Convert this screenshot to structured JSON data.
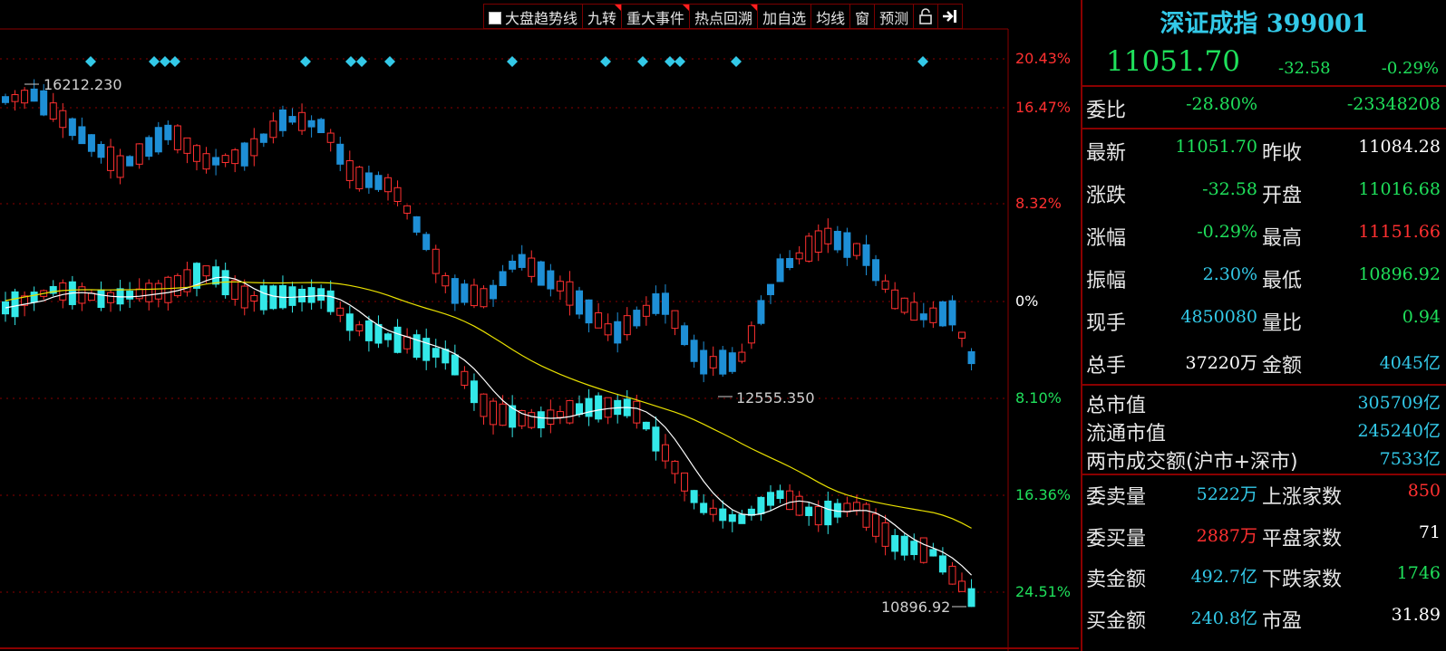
{
  "toolbar": {
    "checkbox_label": "大盘趋势线",
    "items": [
      "九转",
      "重大事件",
      "热点回溯",
      "加自选",
      "均线",
      "窗",
      "预测"
    ]
  },
  "chart_data": {
    "type": "candlestick",
    "reference_close": 11084.28,
    "pct_axis_labels": [
      {
        "label": "20.43%",
        "color": "#ff3030"
      },
      {
        "label": "16.47%",
        "color": "#ff3030"
      },
      {
        "label": "8.32%",
        "color": "#ff3030"
      },
      {
        "label": "0%",
        "color": "#ffffff"
      },
      {
        "label": "8.10%",
        "color": "#1fe05b"
      },
      {
        "label": "16.36%",
        "color": "#1fe05b"
      },
      {
        "label": "24.51%",
        "color": "#1fe05b"
      }
    ],
    "markers": [
      {
        "label": "16212.230",
        "kind": "high"
      },
      {
        "label": "12555.350",
        "kind": "low"
      },
      {
        "label": "10896.92",
        "kind": "low"
      }
    ],
    "colors": {
      "up": "#ff3030",
      "down_main": "#1e8fd6",
      "down_lower": "#33e8e8",
      "ma_short": "#ffffff",
      "ma_long": "#e8e000"
    }
  },
  "panel": {
    "title": "深证成指 399001",
    "price": "11051.70",
    "change": "-32.58",
    "change_pct": "-0.29%",
    "weibi": {
      "label": "委比",
      "pct": "-28.80%",
      "diff": "-23348208"
    },
    "quote_rows": [
      {
        "l1": "最新",
        "v1": "11051.70",
        "c1": "g",
        "l2": "昨收",
        "v2": "11084.28",
        "c2": "w"
      },
      {
        "l1": "涨跌",
        "v1": "-32.58",
        "c1": "g",
        "l2": "开盘",
        "v2": "11016.68",
        "c2": "g"
      },
      {
        "l1": "涨幅",
        "v1": "-0.29%",
        "c1": "g",
        "l2": "最高",
        "v2": "11151.66",
        "c2": "r"
      },
      {
        "l1": "振幅",
        "v1": "2.30%",
        "c1": "c",
        "l2": "最低",
        "v2": "10896.92",
        "c2": "g"
      },
      {
        "l1": "现手",
        "v1": "4850080",
        "c1": "c",
        "l2": "量比",
        "v2": "0.94",
        "c2": "g"
      },
      {
        "l1": "总手",
        "v1": "37220万",
        "c1": "w",
        "l2": "金额",
        "v2": "4045亿",
        "c2": "c"
      }
    ],
    "cap_rows": [
      {
        "label": "总市值",
        "value": "305709亿"
      },
      {
        "label": "流通市值",
        "value": "245240亿"
      },
      {
        "label": "两市成交额(沪市+深市)",
        "value": "7533亿"
      }
    ],
    "order_rows": [
      {
        "l1": "委卖量",
        "v1": "5222万",
        "c1": "c",
        "l2": "上涨家数",
        "v2": "850",
        "c2": "r"
      },
      {
        "l1": "委买量",
        "v1": "2887万",
        "c1": "r",
        "l2": "平盘家数",
        "v2": "71",
        "c2": "w"
      },
      {
        "l1": "卖金额",
        "v1": "492.7亿",
        "c1": "c",
        "l2": "下跌家数",
        "v2": "1746",
        "c2": "g"
      },
      {
        "l1": "买金额",
        "v1": "240.8亿",
        "c1": "c",
        "l2": "市盈",
        "v2": "31.89",
        "c2": "w"
      }
    ]
  }
}
